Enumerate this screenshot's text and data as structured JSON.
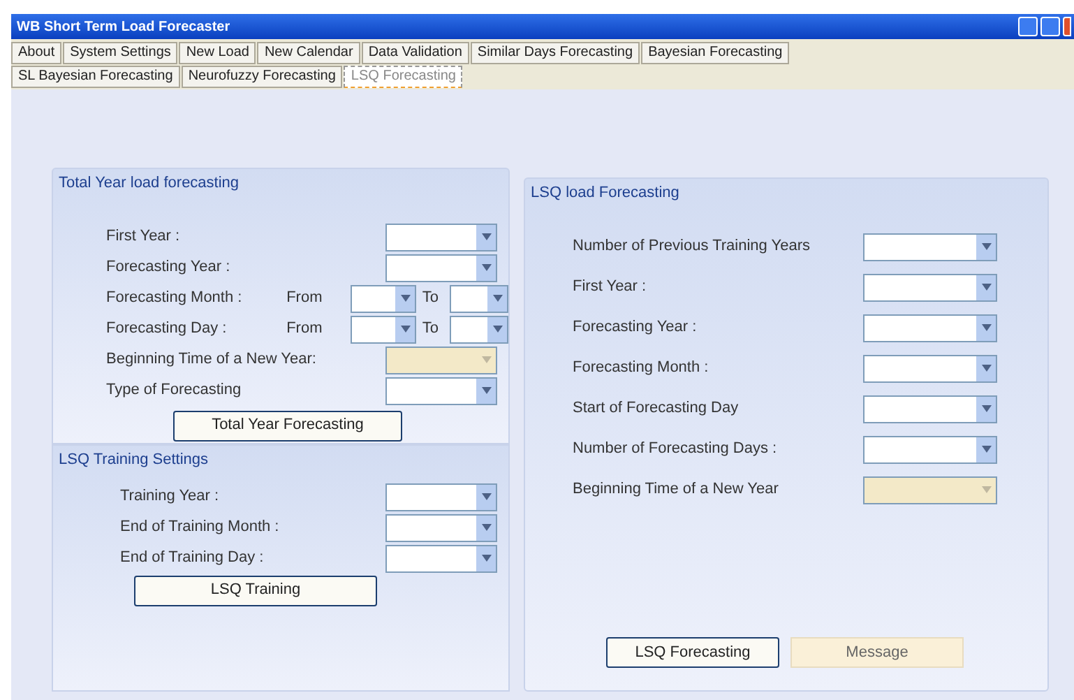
{
  "window": {
    "title": "WB Short Term Load Forecaster"
  },
  "tabs": [
    {
      "label": "About",
      "selected": false
    },
    {
      "label": "System Settings",
      "selected": false
    },
    {
      "label": "New Load",
      "selected": false
    },
    {
      "label": "New Calendar",
      "selected": false
    },
    {
      "label": "Data Validation",
      "selected": false
    },
    {
      "label": "Similar Days Forecasting",
      "selected": false
    },
    {
      "label": "Bayesian Forecasting",
      "selected": false
    },
    {
      "label": "SL Bayesian Forecasting",
      "selected": false
    },
    {
      "label": "Neurofuzzy Forecasting",
      "selected": false
    },
    {
      "label": "LSQ Forecasting",
      "selected": true
    }
  ],
  "total_year_group": {
    "title": "Total Year load forecasting",
    "rows": [
      {
        "kind": "combo",
        "label": "First Year :",
        "disabled": false
      },
      {
        "kind": "combo",
        "label": "Forecasting Year :",
        "disabled": false
      },
      {
        "kind": "range",
        "label": "Forecasting Month :",
        "from": "From",
        "to": "To"
      },
      {
        "kind": "range",
        "label": "Forecasting Day :",
        "from": "From",
        "to": "To"
      },
      {
        "kind": "combo",
        "label": "Beginning Time of a New Year:",
        "disabled": true
      },
      {
        "kind": "combo",
        "label": "Type of Forecasting",
        "disabled": false
      }
    ],
    "button": {
      "label": "Total Year Forecasting",
      "disabled": false
    }
  },
  "training_group": {
    "title": "LSQ Training Settings",
    "rows": [
      {
        "kind": "combo",
        "label": "Training Year :",
        "disabled": false
      },
      {
        "kind": "combo",
        "label": "End of Training Month :",
        "disabled": false
      },
      {
        "kind": "combo",
        "label": "End of Training Day :",
        "disabled": false
      }
    ],
    "button": {
      "label": "LSQ Training",
      "disabled": false
    }
  },
  "lsq_group": {
    "title": "LSQ load Forecasting",
    "rows": [
      {
        "kind": "combo",
        "label": "Number of Previous Training Years",
        "disabled": false
      },
      {
        "kind": "combo",
        "label": "First Year :",
        "disabled": false
      },
      {
        "kind": "combo",
        "label": "Forecasting Year :",
        "disabled": false
      },
      {
        "kind": "combo",
        "label": "Forecasting Month :",
        "disabled": false
      },
      {
        "kind": "combo",
        "label": "Start of Forecasting Day",
        "disabled": false
      },
      {
        "kind": "combo",
        "label": "Number of Forecasting Days :",
        "disabled": false
      },
      {
        "kind": "combo",
        "label": "Beginning Time of a New Year",
        "disabled": true
      }
    ],
    "buttons": [
      {
        "label": "LSQ Forecasting",
        "disabled": false
      },
      {
        "label": "Message",
        "disabled": true
      }
    ]
  }
}
